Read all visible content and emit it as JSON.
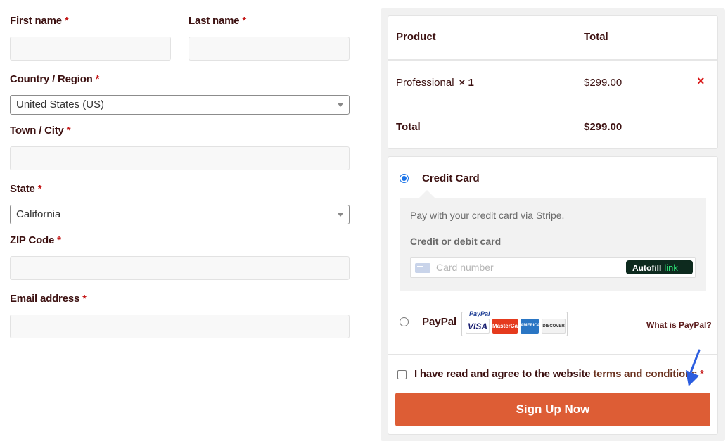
{
  "form": {
    "required_mark": "*",
    "first_name_label": "First name",
    "last_name_label": "Last name",
    "country_label": "Country / Region",
    "country_value": "United States (US)",
    "city_label": "Town / City",
    "state_label": "State",
    "state_value": "California",
    "zip_label": "ZIP Code",
    "email_label": "Email address"
  },
  "order": {
    "col_product": "Product",
    "col_total": "Total",
    "item_name": "Professional",
    "item_qty": "× 1",
    "item_price": "$299.00",
    "remove_icon": "×",
    "total_label": "Total",
    "total_value": "$299.00"
  },
  "payment": {
    "credit_card_title": "Credit Card",
    "credit_card_selected": true,
    "stripe_desc": "Pay with your credit card via Stripe.",
    "card_label": "Credit or debit card",
    "card_placeholder": "Card number",
    "autofill_label": "Autofill",
    "link_label": "link",
    "paypal_title": "PayPal",
    "paypal_logo_text": "PayPal",
    "visa_text": "VISA",
    "mastercard_text": "MasterCard",
    "amex_text": "AMERICAN EXPRESS",
    "discover_text": "DISCOVER",
    "what_is_paypal": "What is PayPal?"
  },
  "terms": {
    "text": "I have read and agree to the website",
    "link": "terms and conditions",
    "required_mark": "*"
  },
  "signup_label": "Sign Up Now",
  "colors": {
    "accent_button": "#dd5d35",
    "label_text": "#3d1212",
    "required": "#c51a1a",
    "radio_selected": "#1a73e8",
    "arrow": "#2b5de0"
  }
}
